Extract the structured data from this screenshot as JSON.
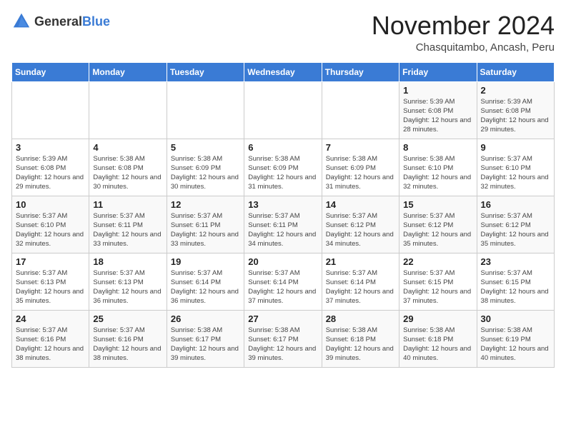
{
  "logo": {
    "general": "General",
    "blue": "Blue"
  },
  "title": "November 2024",
  "location": "Chasquitambo, Ancash, Peru",
  "days_of_week": [
    "Sunday",
    "Monday",
    "Tuesday",
    "Wednesday",
    "Thursday",
    "Friday",
    "Saturday"
  ],
  "weeks": [
    [
      {
        "day": "",
        "info": ""
      },
      {
        "day": "",
        "info": ""
      },
      {
        "day": "",
        "info": ""
      },
      {
        "day": "",
        "info": ""
      },
      {
        "day": "",
        "info": ""
      },
      {
        "day": "1",
        "info": "Sunrise: 5:39 AM\nSunset: 6:08 PM\nDaylight: 12 hours and 28 minutes."
      },
      {
        "day": "2",
        "info": "Sunrise: 5:39 AM\nSunset: 6:08 PM\nDaylight: 12 hours and 29 minutes."
      }
    ],
    [
      {
        "day": "3",
        "info": "Sunrise: 5:39 AM\nSunset: 6:08 PM\nDaylight: 12 hours and 29 minutes."
      },
      {
        "day": "4",
        "info": "Sunrise: 5:38 AM\nSunset: 6:08 PM\nDaylight: 12 hours and 30 minutes."
      },
      {
        "day": "5",
        "info": "Sunrise: 5:38 AM\nSunset: 6:09 PM\nDaylight: 12 hours and 30 minutes."
      },
      {
        "day": "6",
        "info": "Sunrise: 5:38 AM\nSunset: 6:09 PM\nDaylight: 12 hours and 31 minutes."
      },
      {
        "day": "7",
        "info": "Sunrise: 5:38 AM\nSunset: 6:09 PM\nDaylight: 12 hours and 31 minutes."
      },
      {
        "day": "8",
        "info": "Sunrise: 5:38 AM\nSunset: 6:10 PM\nDaylight: 12 hours and 32 minutes."
      },
      {
        "day": "9",
        "info": "Sunrise: 5:37 AM\nSunset: 6:10 PM\nDaylight: 12 hours and 32 minutes."
      }
    ],
    [
      {
        "day": "10",
        "info": "Sunrise: 5:37 AM\nSunset: 6:10 PM\nDaylight: 12 hours and 32 minutes."
      },
      {
        "day": "11",
        "info": "Sunrise: 5:37 AM\nSunset: 6:11 PM\nDaylight: 12 hours and 33 minutes."
      },
      {
        "day": "12",
        "info": "Sunrise: 5:37 AM\nSunset: 6:11 PM\nDaylight: 12 hours and 33 minutes."
      },
      {
        "day": "13",
        "info": "Sunrise: 5:37 AM\nSunset: 6:11 PM\nDaylight: 12 hours and 34 minutes."
      },
      {
        "day": "14",
        "info": "Sunrise: 5:37 AM\nSunset: 6:12 PM\nDaylight: 12 hours and 34 minutes."
      },
      {
        "day": "15",
        "info": "Sunrise: 5:37 AM\nSunset: 6:12 PM\nDaylight: 12 hours and 35 minutes."
      },
      {
        "day": "16",
        "info": "Sunrise: 5:37 AM\nSunset: 6:12 PM\nDaylight: 12 hours and 35 minutes."
      }
    ],
    [
      {
        "day": "17",
        "info": "Sunrise: 5:37 AM\nSunset: 6:13 PM\nDaylight: 12 hours and 35 minutes."
      },
      {
        "day": "18",
        "info": "Sunrise: 5:37 AM\nSunset: 6:13 PM\nDaylight: 12 hours and 36 minutes."
      },
      {
        "day": "19",
        "info": "Sunrise: 5:37 AM\nSunset: 6:14 PM\nDaylight: 12 hours and 36 minutes."
      },
      {
        "day": "20",
        "info": "Sunrise: 5:37 AM\nSunset: 6:14 PM\nDaylight: 12 hours and 37 minutes."
      },
      {
        "day": "21",
        "info": "Sunrise: 5:37 AM\nSunset: 6:14 PM\nDaylight: 12 hours and 37 minutes."
      },
      {
        "day": "22",
        "info": "Sunrise: 5:37 AM\nSunset: 6:15 PM\nDaylight: 12 hours and 37 minutes."
      },
      {
        "day": "23",
        "info": "Sunrise: 5:37 AM\nSunset: 6:15 PM\nDaylight: 12 hours and 38 minutes."
      }
    ],
    [
      {
        "day": "24",
        "info": "Sunrise: 5:37 AM\nSunset: 6:16 PM\nDaylight: 12 hours and 38 minutes."
      },
      {
        "day": "25",
        "info": "Sunrise: 5:37 AM\nSunset: 6:16 PM\nDaylight: 12 hours and 38 minutes."
      },
      {
        "day": "26",
        "info": "Sunrise: 5:38 AM\nSunset: 6:17 PM\nDaylight: 12 hours and 39 minutes."
      },
      {
        "day": "27",
        "info": "Sunrise: 5:38 AM\nSunset: 6:17 PM\nDaylight: 12 hours and 39 minutes."
      },
      {
        "day": "28",
        "info": "Sunrise: 5:38 AM\nSunset: 6:18 PM\nDaylight: 12 hours and 39 minutes."
      },
      {
        "day": "29",
        "info": "Sunrise: 5:38 AM\nSunset: 6:18 PM\nDaylight: 12 hours and 40 minutes."
      },
      {
        "day": "30",
        "info": "Sunrise: 5:38 AM\nSunset: 6:19 PM\nDaylight: 12 hours and 40 minutes."
      }
    ]
  ]
}
